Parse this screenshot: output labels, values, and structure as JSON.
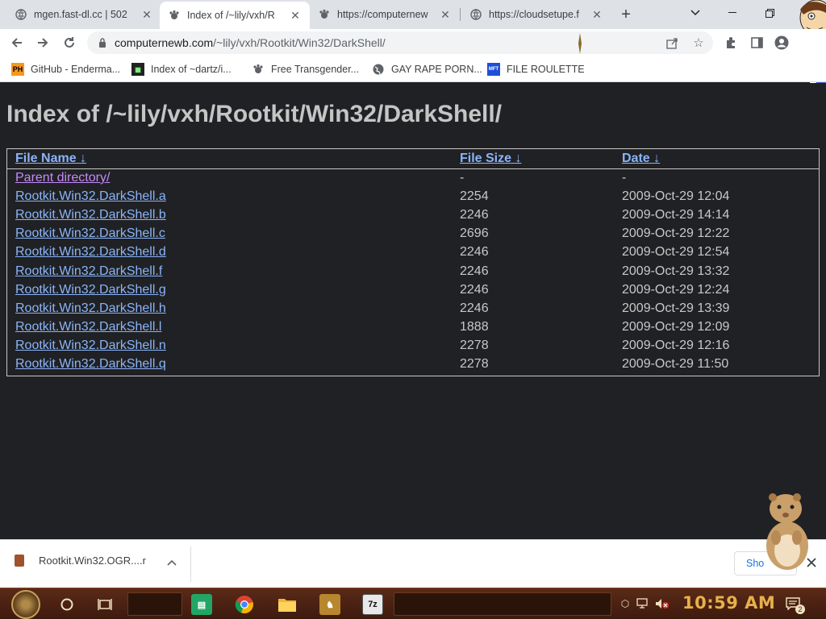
{
  "tabs": [
    {
      "title": "mgen.fast-dl.cc | 502",
      "active": false
    },
    {
      "title": "Index of /~lily/vxh/R",
      "active": true
    },
    {
      "title": "https://computernew",
      "active": false
    },
    {
      "title": "https://cloudsetupe.f",
      "active": false
    }
  ],
  "toolbar": {
    "url_host": "computernewb.com",
    "url_path": "/~lily/vxh/Rootkit/Win32/DarkShell/"
  },
  "bookmarks": [
    {
      "label": "GitHub - Enderma...",
      "icon": "ph-icon",
      "icon_text": "PH"
    },
    {
      "label": "Index of ~dartz/i...",
      "icon": "folder-grid-icon"
    },
    {
      "label": "Free Transgender...",
      "icon": "globe-paw-icon"
    },
    {
      "label": "GAY RAPE PORN...",
      "icon": "globe-icon"
    },
    {
      "label": "FILE ROULETTE",
      "icon": "mft-icon",
      "icon_text": "MFT"
    }
  ],
  "page": {
    "heading": "Index of /~lily/vxh/Rootkit/Win32/DarkShell/",
    "columns": {
      "name": "File Name",
      "size": "File Size",
      "date": "Date",
      "sort_glyph": "↓"
    },
    "parent": {
      "name": "Parent directory/",
      "size": "-",
      "date": "-"
    },
    "rows": [
      {
        "name": "Rootkit.Win32.DarkShell.a",
        "size": "2254",
        "date": "2009-Oct-29 12:04"
      },
      {
        "name": "Rootkit.Win32.DarkShell.b",
        "size": "2246",
        "date": "2009-Oct-29 14:14"
      },
      {
        "name": "Rootkit.Win32.DarkShell.c",
        "size": "2696",
        "date": "2009-Oct-29 12:22"
      },
      {
        "name": "Rootkit.Win32.DarkShell.d",
        "size": "2246",
        "date": "2009-Oct-29 12:54"
      },
      {
        "name": "Rootkit.Win32.DarkShell.f",
        "size": "2246",
        "date": "2009-Oct-29 13:32"
      },
      {
        "name": "Rootkit.Win32.DarkShell.g",
        "size": "2246",
        "date": "2009-Oct-29 12:24"
      },
      {
        "name": "Rootkit.Win32.DarkShell.h",
        "size": "2246",
        "date": "2009-Oct-29 13:39"
      },
      {
        "name": "Rootkit.Win32.DarkShell.l",
        "size": "1888",
        "date": "2009-Oct-29 12:09"
      },
      {
        "name": "Rootkit.Win32.DarkShell.n",
        "size": "2278",
        "date": "2009-Oct-29 12:16"
      },
      {
        "name": "Rootkit.Win32.DarkShell.q",
        "size": "2278",
        "date": "2009-Oct-29 11:50"
      }
    ]
  },
  "download": {
    "filename": "Rootkit.Win32.OGR....r",
    "show_all_label": "Sho"
  },
  "taskbar": {
    "apps": [
      {
        "name": "sheets-app",
        "color": "#23a566",
        "glyph": "▤"
      },
      {
        "name": "chrome-app",
        "color": "#db4437",
        "glyph": "●"
      },
      {
        "name": "file-explorer-app",
        "color": "#f2b632",
        "glyph": "▬"
      },
      {
        "name": "game-app",
        "color": "#b8862e",
        "glyph": "♞"
      },
      {
        "name": "7zip-app",
        "color": "#222222",
        "glyph": "7z"
      }
    ],
    "clock": "10:59 AM",
    "notification_count": "2"
  },
  "colors": {
    "page_bg": "#202124",
    "link": "#8ab4f8",
    "visited_link": "#c58af9",
    "clock": "#e8b04a"
  }
}
